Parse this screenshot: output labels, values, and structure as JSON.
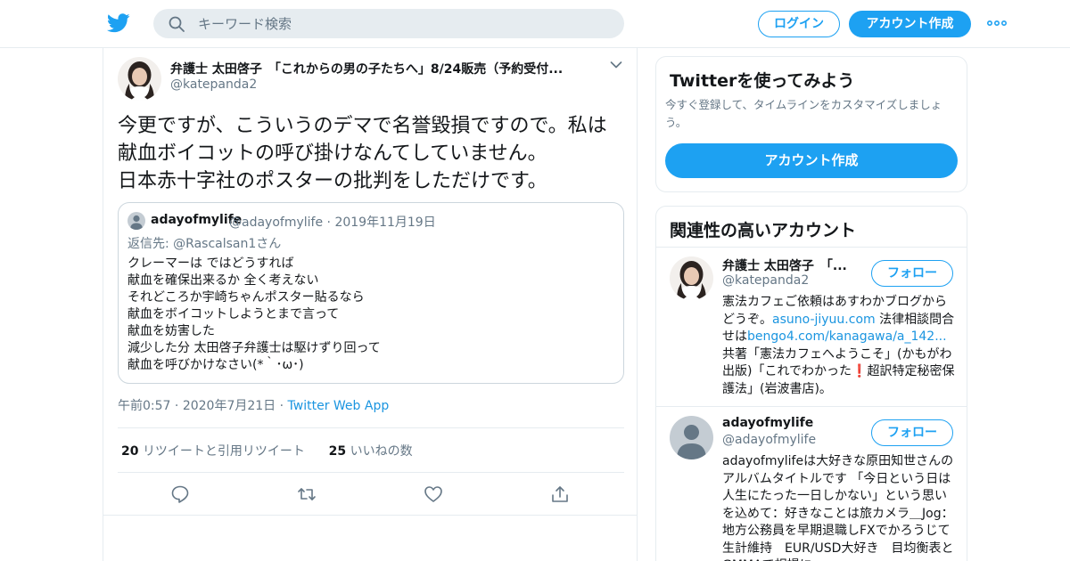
{
  "header": {
    "search_placeholder": "キーワード検索",
    "login_label": "ログイン",
    "signup_label": "アカウント作成"
  },
  "tweet": {
    "author_name": "弁護士 太田啓子　「これからの男の子たちへ」8/24販売（予約受付...",
    "author_handle": "@katepanda2",
    "text": "今更ですが、こういうのデマで名誉毀損ですので。私は献血ボイコットの呼び掛けなんてしていません。\n日本赤十字社のポスターの批判をしただけです。",
    "quote": {
      "name": "adayofmylife",
      "handle": "@adayofmylife",
      "date": "2019年11月19日",
      "reply_prefix": "返信先: ",
      "reply_to": "@Rascalsan1さん",
      "body": "クレーマーは ではどうすれば\n献血を確保出来るか 全く考えない\nそれどころか宇崎ちゃんポスター貼るなら\n献血をボイコットしようとまで言って\n献血を妨害した\n減少した分 太田啓子弁護士は駆けずり回って\n献血を呼びかけなさい(*｀･ω･)"
    },
    "time": "午前0:57",
    "date": "2020年7月21日",
    "source": "Twitter Web App",
    "retweet_count": "20",
    "retweet_label": "リツイートと引用リツイート",
    "like_count": "25",
    "like_label": "いいねの数"
  },
  "sidebar": {
    "signup_card": {
      "title": "Twitterを使ってみよう",
      "desc": "今すぐ登録して、タイムラインをカスタマイズしましょう。",
      "button": "アカウント作成"
    },
    "related": {
      "title": "関連性の高いアカウント",
      "accounts": [
        {
          "name": "弁護士 太田啓子　「...",
          "handle": "@katepanda2",
          "follow": "フォロー",
          "bio_1": "憲法カフェご依頼はあすわかブログからどうぞ。",
          "bio_link_1": "asuno-jiyuu.com",
          "bio_2": " 法律相談問合せは",
          "bio_link_2": "bengo4.com/kanagawa/a_142...",
          "bio_3": " 共著「憲法カフェへようこそ」(かもがわ出版)「これでわかった",
          "bio_emoji": "❗",
          "bio_4": "超訳特定秘密保護法」(岩波書店)。"
        },
        {
          "name": "adayofmylife",
          "handle": "@adayofmylife",
          "follow": "フォロー",
          "bio": "adayofmylifeは大好きな原田知世さんのアルバムタイトルです 「今日という日は人生にたった一日しかない」という思いを込めて：好きなことは旅カメラ＿Jog： 地方公務員を早期退職しFXでかろうじて生計維持　EUR/USD大好き　目均衡表とGMMAで相場に"
        }
      ]
    }
  },
  "colors": {
    "accent": "#1da1f2",
    "link": "#1b95e0",
    "secondary_text": "#657786",
    "border": "#e6ecf0"
  }
}
